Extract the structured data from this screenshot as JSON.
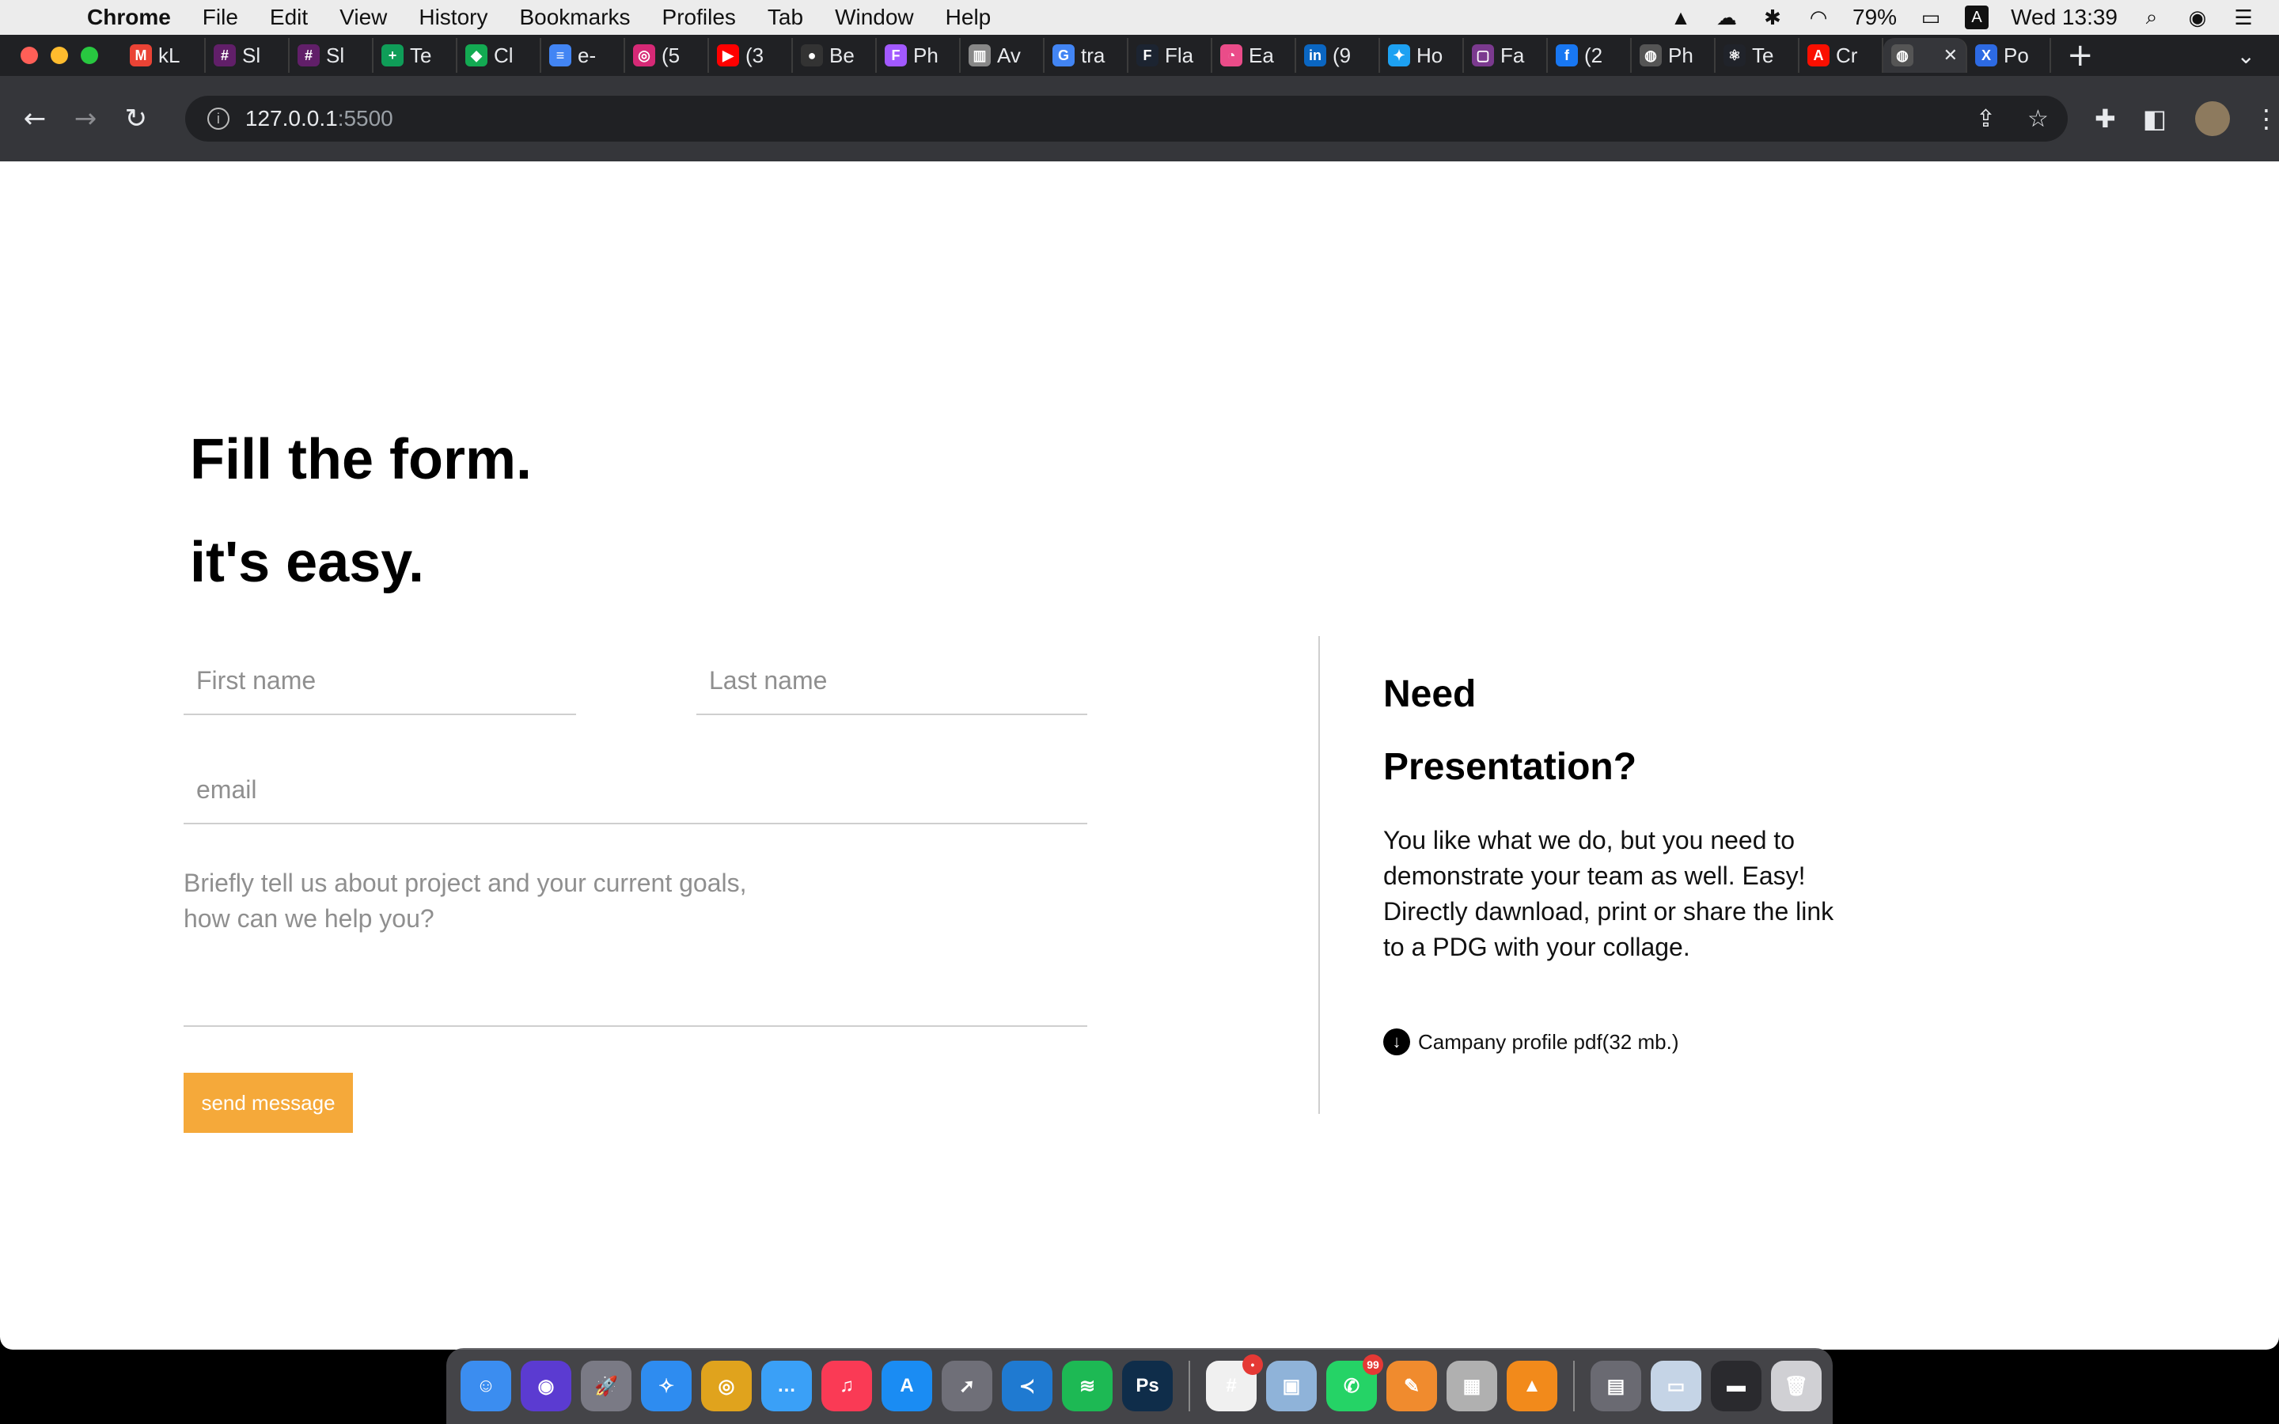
{
  "menubar": {
    "app_name": "Chrome",
    "items": [
      "File",
      "Edit",
      "View",
      "History",
      "Bookmarks",
      "Profiles",
      "Tab",
      "Window",
      "Help"
    ],
    "battery": "79%",
    "clock": "Wed 13:39",
    "input_source": "A"
  },
  "tabs": [
    {
      "label": "kL",
      "icon": "gmail-icon",
      "color": "#ea4335",
      "glyph": "M"
    },
    {
      "label": "Sl",
      "icon": "slack-icon",
      "color": "#611f69",
      "glyph": "#"
    },
    {
      "label": "Sl",
      "icon": "slack-icon",
      "color": "#611f69",
      "glyph": "#"
    },
    {
      "label": "Te",
      "icon": "sheets-icon",
      "color": "#0f9d58",
      "glyph": "+"
    },
    {
      "label": "Cl",
      "icon": "mongodb-icon",
      "color": "#13aa52",
      "glyph": "◆"
    },
    {
      "label": "e-",
      "icon": "docs-icon",
      "color": "#4285f4",
      "glyph": "≡"
    },
    {
      "label": "(5",
      "icon": "instagram-icon",
      "color": "#d62976",
      "glyph": "◎"
    },
    {
      "label": "(3",
      "icon": "youtube-icon",
      "color": "#ff0000",
      "glyph": "▶"
    },
    {
      "label": "Be",
      "icon": "github-icon",
      "color": "#333333",
      "glyph": "●"
    },
    {
      "label": "Ph",
      "icon": "figma-icon",
      "color": "#a259ff",
      "glyph": "F"
    },
    {
      "label": "Av",
      "icon": "trello-icon",
      "color": "#888888",
      "glyph": "▥"
    },
    {
      "label": "tra",
      "icon": "google-icon",
      "color": "#4285f4",
      "glyph": "G"
    },
    {
      "label": "Fla",
      "icon": "flaticon-icon",
      "color": "#1c2431",
      "glyph": "F"
    },
    {
      "label": "Ea",
      "icon": "dribbble-icon",
      "color": "#ea4c89",
      "glyph": "◔"
    },
    {
      "label": "(9",
      "icon": "linkedin-icon",
      "color": "#0a66c2",
      "glyph": "in"
    },
    {
      "label": "Ho",
      "icon": "twitter-icon",
      "color": "#1da1f2",
      "glyph": "✦"
    },
    {
      "label": "Fa",
      "icon": "app-icon",
      "color": "#7b3a8f",
      "glyph": "▢"
    },
    {
      "label": "(2",
      "icon": "facebook-icon",
      "color": "#1877f2",
      "glyph": "f"
    },
    {
      "label": "Ph",
      "icon": "globe-icon",
      "color": "#555555",
      "glyph": "◍"
    },
    {
      "label": "Te",
      "icon": "react-icon",
      "color": "#20232a",
      "glyph": "⚛"
    },
    {
      "label": "Cr",
      "icon": "adobe-icon",
      "color": "#fa0f00",
      "glyph": "A"
    },
    {
      "label": "",
      "icon": "globe-icon",
      "color": "#555555",
      "glyph": "◍",
      "active": true
    },
    {
      "label": "Po",
      "icon": "xd-icon",
      "color": "#2d6ae3",
      "glyph": "X"
    }
  ],
  "address_bar": {
    "host": "127.0.0.1",
    "port": ":5500"
  },
  "page": {
    "heading_line1": "Fill the form.",
    "heading_line2": "it's easy.",
    "form": {
      "first_name_placeholder": "First name",
      "last_name_placeholder": "Last name",
      "email_placeholder": "email",
      "message_line1": "Briefly tell us about project and your current goals,",
      "message_line2": "how can we help you?",
      "send_label": "send message",
      "send_color": "#f5a93a"
    },
    "side": {
      "title_line1": "Need",
      "title_line2": "Presentation?",
      "text_line1": "You like what we do, but you need to",
      "text_line2": "demonstrate your team as well. Easy!",
      "text_line3": "Directly dawnload, print or share the link",
      "text_line4": "to a PDG with your collage.",
      "download_label": "Campany profile pdf(32 mb.)"
    }
  },
  "dock": {
    "apps": [
      {
        "name": "finder-icon",
        "color": "#3b8df0",
        "glyph": "☺"
      },
      {
        "name": "siri-icon",
        "color": "#5b3bd1",
        "glyph": "◉"
      },
      {
        "name": "launchpad-icon",
        "color": "#7a7a85",
        "glyph": "🚀"
      },
      {
        "name": "safari-icon",
        "color": "#2e8cf0",
        "glyph": "✧"
      },
      {
        "name": "chrome-icon",
        "color": "#e0a31d",
        "glyph": "◎"
      },
      {
        "name": "messages-icon",
        "color": "#3aa0f7",
        "glyph": "…"
      },
      {
        "name": "music-icon",
        "color": "#fa3a55",
        "glyph": "♫"
      },
      {
        "name": "app-store-icon",
        "color": "#1a8cf3",
        "glyph": "A"
      },
      {
        "name": "rocket-icon",
        "color": "#6f6f78",
        "glyph": "➚"
      },
      {
        "name": "vscode-icon",
        "color": "#1f7ad1",
        "glyph": "≺"
      },
      {
        "name": "spotify-icon",
        "color": "#1db954",
        "glyph": "≋"
      },
      {
        "name": "photoshop-icon",
        "color": "#0f2d4a",
        "glyph": "Ps"
      },
      {
        "name": "slack-icon",
        "color": "#f0f0f0",
        "glyph": "#",
        "badge": "•"
      },
      {
        "name": "preview-icon",
        "color": "#8fb3d9",
        "glyph": "▣"
      },
      {
        "name": "whatsapp-icon",
        "color": "#25d366",
        "glyph": "✆",
        "badge": "99"
      },
      {
        "name": "sketch-icon",
        "color": "#f08b2e",
        "glyph": "✎"
      },
      {
        "name": "calculator-icon",
        "color": "#b0b0b0",
        "glyph": "▦"
      },
      {
        "name": "vlc-icon",
        "color": "#f28a1b",
        "glyph": "▲"
      },
      {
        "name": "downloads-icon",
        "color": "#6a6a72",
        "glyph": "▤"
      },
      {
        "name": "screenshot-icon",
        "color": "#c5d4e6",
        "glyph": "▭"
      },
      {
        "name": "terminal-icon",
        "color": "#2a2a2e",
        "glyph": "▬"
      },
      {
        "name": "trash-icon",
        "color": "#d0d0d4",
        "glyph": "🗑"
      }
    ]
  }
}
